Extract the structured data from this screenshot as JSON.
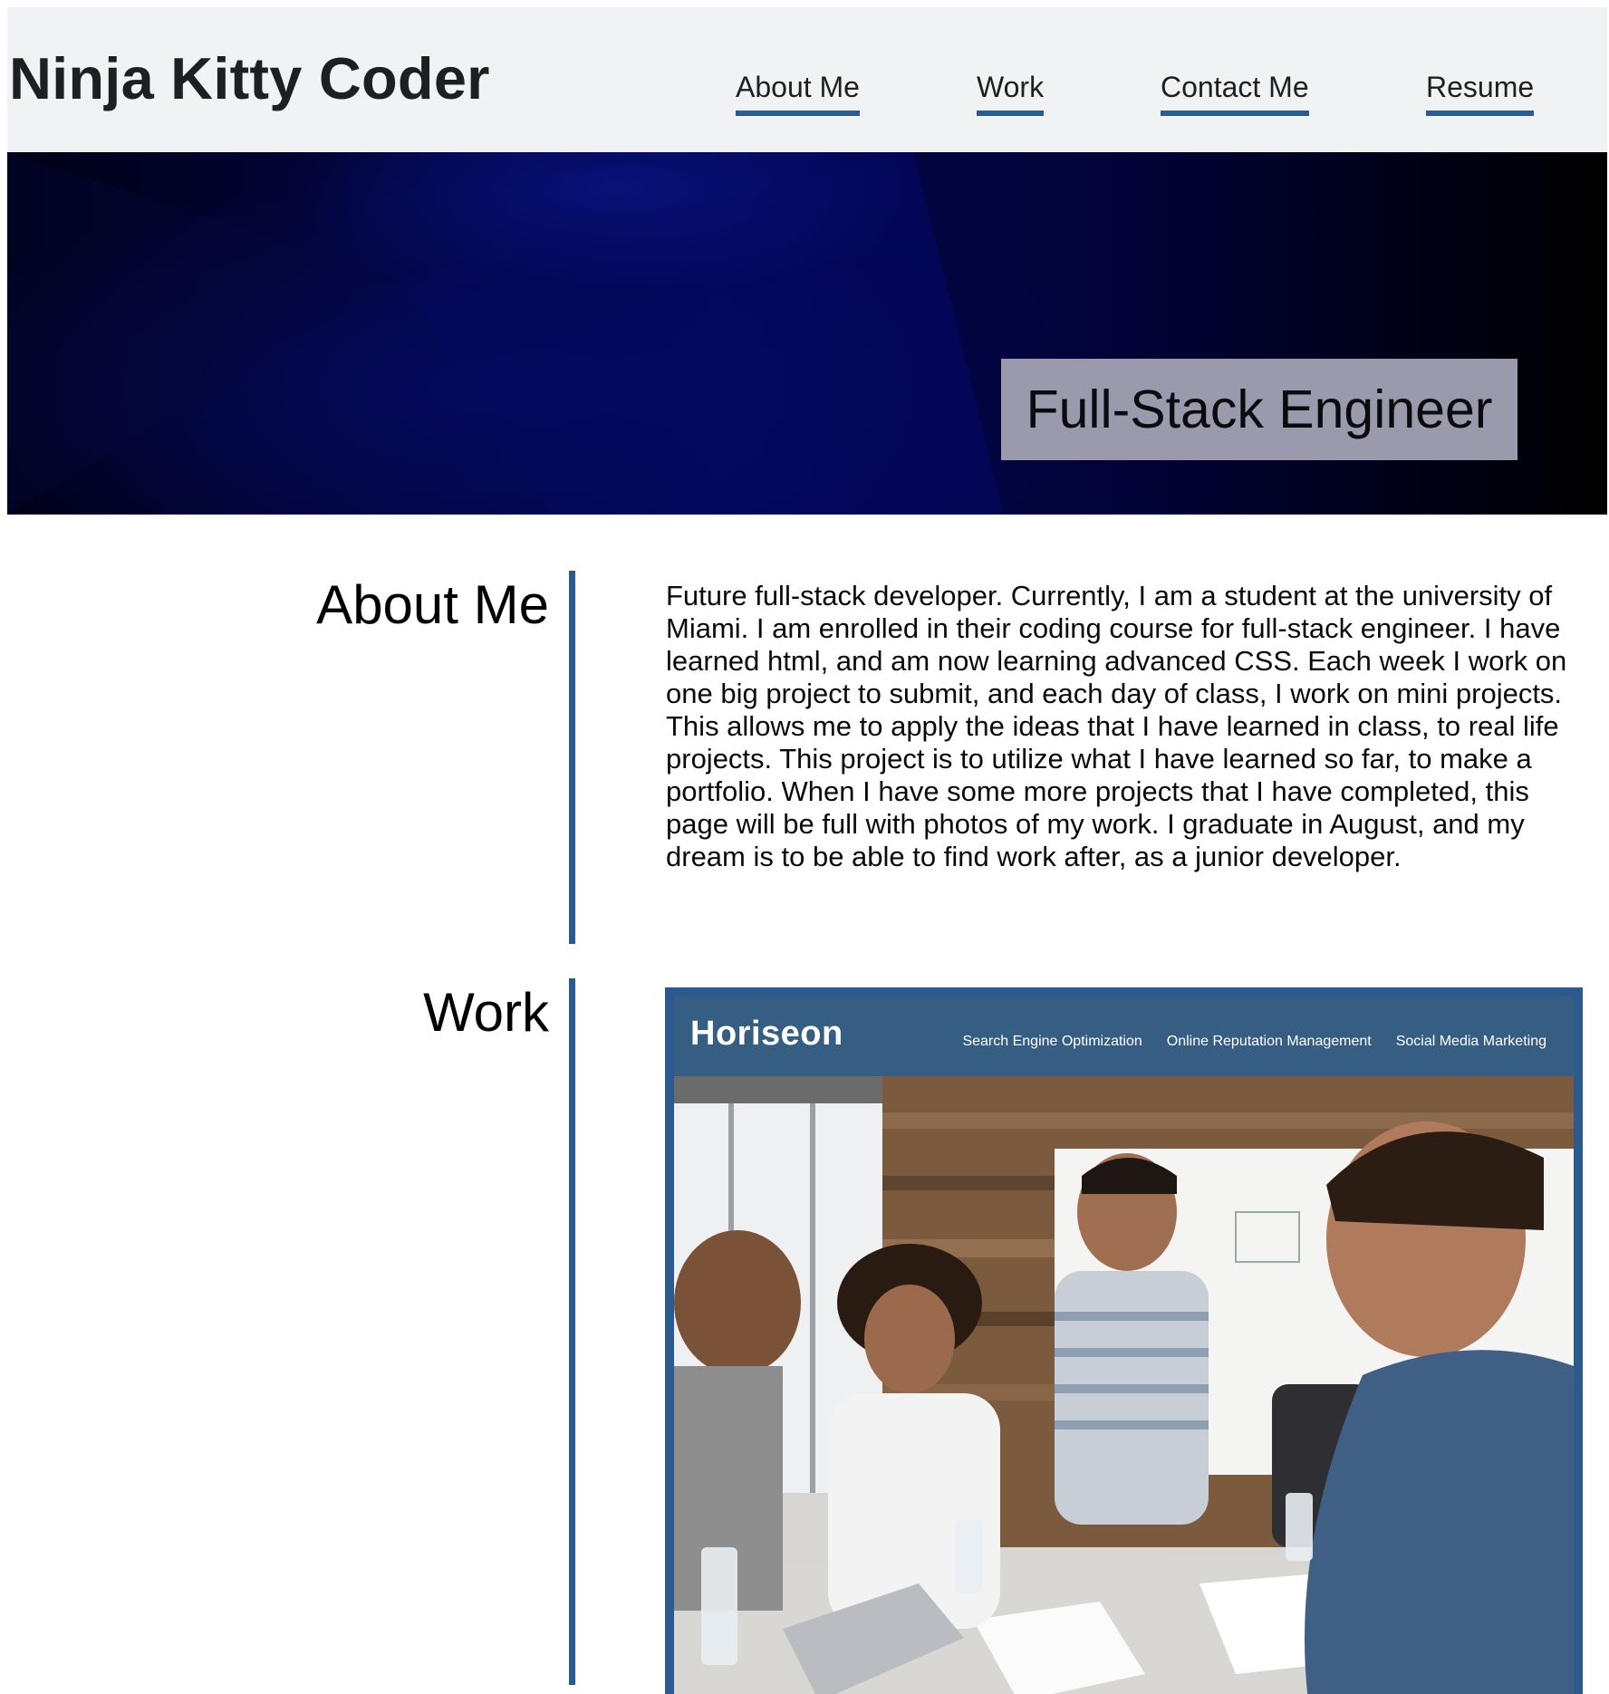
{
  "header": {
    "site_title": "Ninja Kitty Coder",
    "nav": [
      {
        "label": "About Me"
      },
      {
        "label": "Work"
      },
      {
        "label": "Contact Me"
      },
      {
        "label": "Resume"
      }
    ]
  },
  "hero": {
    "tagline": "Full-Stack Engineer"
  },
  "about": {
    "heading": "About Me",
    "body": "Future full-stack developer. Currently, I am a student at the university of Miami. I am enrolled in their coding course for full-stack engineer. I have learned html, and am now learning advanced CSS. Each week I work on one big project to submit, and each day of class, I work on mini projects. This allows me to apply the ideas that I have learned in class, to real life projects. This project is to utilize what I have learned so far, to make a portfolio. When I have some more projects that I have completed, this page will be full with photos of my work. I graduate in August, and my dream is to be able to find work after, as a junior developer."
  },
  "work": {
    "heading": "Work",
    "project": {
      "brand": "Horiseon",
      "links": [
        "Search Engine Optimization",
        "Online Reputation Management",
        "Social Media Marketing"
      ]
    }
  },
  "colors": {
    "accent": "#2b5a8f",
    "header_bg": "#f1f2f4",
    "hero_dark": "#02043e",
    "tagline_bg": "#9a9aac",
    "project_nav_bg": "#355e82"
  }
}
